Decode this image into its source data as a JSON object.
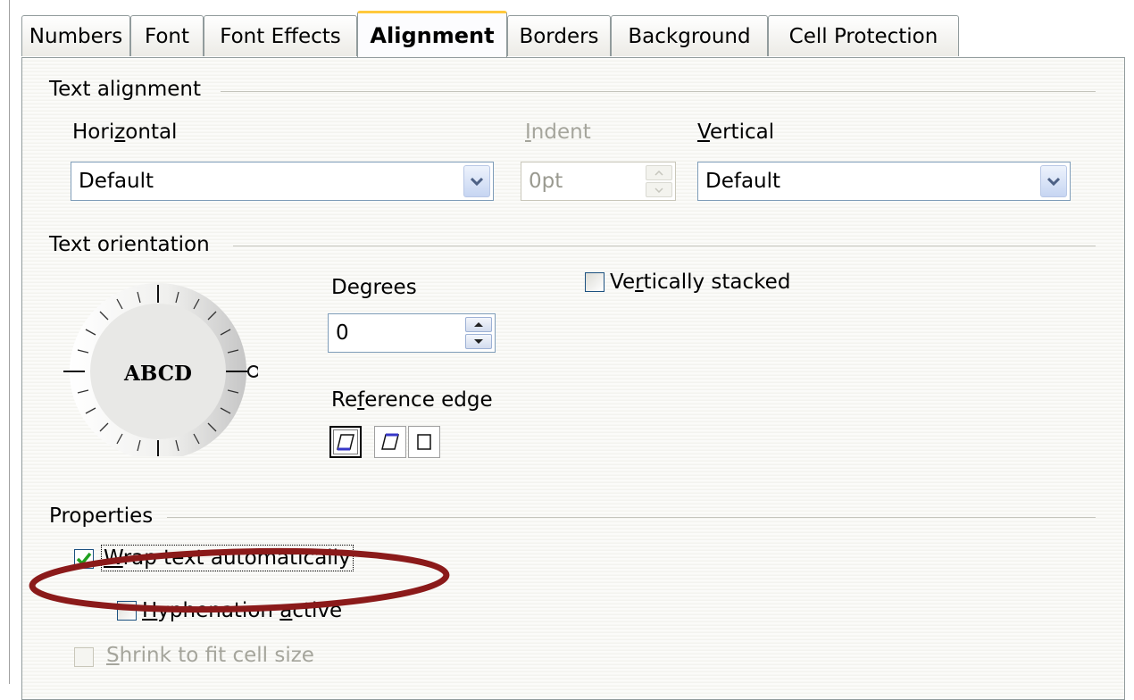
{
  "tabs": [
    "Numbers",
    "Font",
    "Font Effects",
    "Alignment",
    "Borders",
    "Background",
    "Cell Protection"
  ],
  "active_tab": "Alignment",
  "text_alignment": {
    "title": "Text alignment",
    "horizontal": {
      "label_pre": "Hori",
      "label_u": "z",
      "label_post": "ontal",
      "value": "Default"
    },
    "indent": {
      "label_pre": "",
      "label_u": "I",
      "label_post": "ndent",
      "value": "0pt"
    },
    "vertical": {
      "label_pre": "",
      "label_u": "V",
      "label_post": "ertical",
      "value": "Default"
    }
  },
  "text_orientation": {
    "title": "Text orientation",
    "dial_text": "ABCD",
    "degrees_label": "Degrees",
    "degrees_value": "0",
    "vertically_stacked": {
      "label_pre": "Ve",
      "label_u": "r",
      "label_post": "tically stacked",
      "checked": false
    },
    "reference_edge": {
      "label_pre": "Re",
      "label_u": "f",
      "label_post": "erence edge"
    }
  },
  "properties": {
    "title": "Properties",
    "wrap": {
      "label_pre": "",
      "label_u": "W",
      "label_post": "rap text automatically",
      "checked": true
    },
    "hyphenation": {
      "label_pre": "",
      "label_u": "H",
      "label_post": "yphenation ",
      "label_u2": "a",
      "label_post2": "ctive",
      "checked": false
    },
    "shrink": {
      "label_pre": "",
      "label_u": "S",
      "label_post": "hrink to fit cell size",
      "checked": false,
      "disabled": true
    }
  },
  "colors": {
    "highlight_ellipse": "#8b1a1a",
    "checkmark": "#21a121",
    "tab_active_top": "#ffc83c"
  }
}
